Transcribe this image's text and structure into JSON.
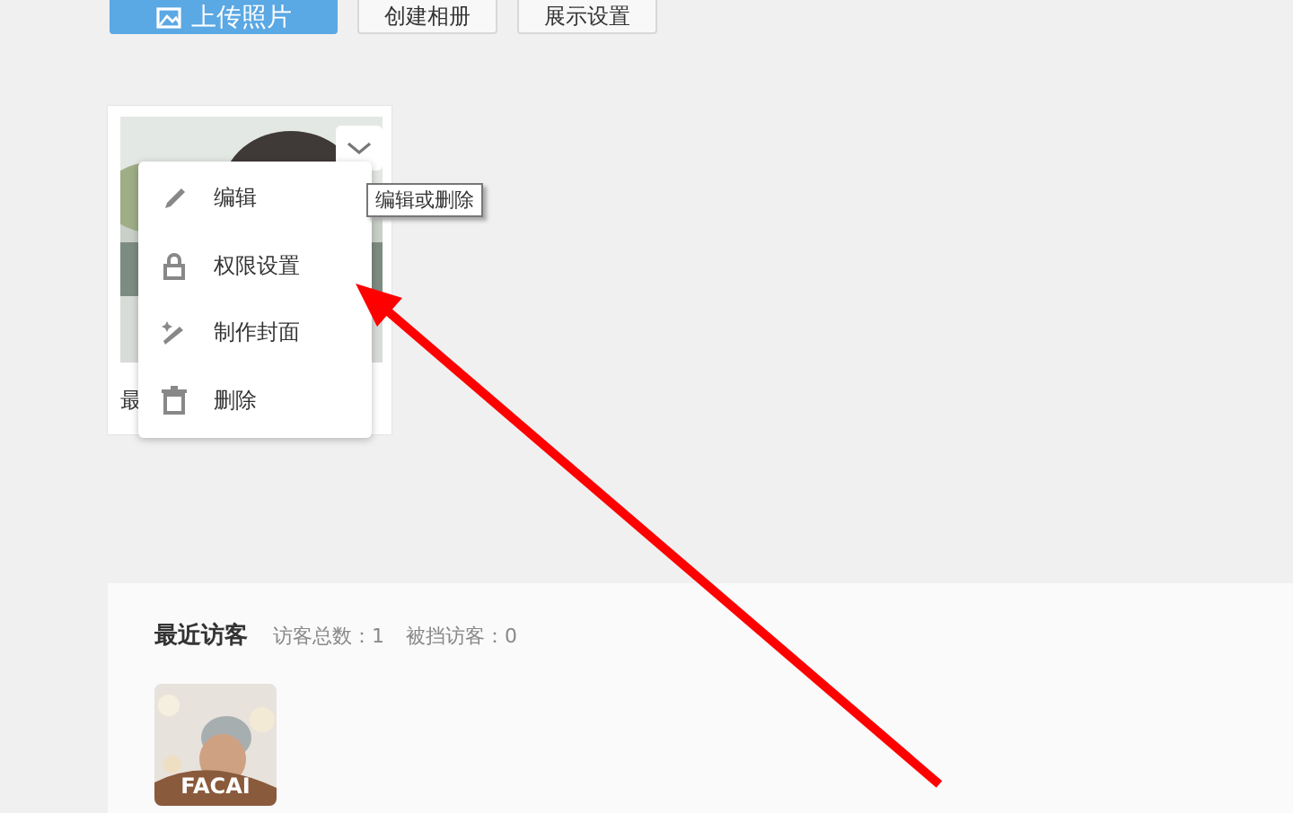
{
  "toolbar": {
    "buttons": [
      {
        "label": "上传照片",
        "kind": "primary"
      },
      {
        "label": "创建相册",
        "kind": "default"
      },
      {
        "label": "展示设置",
        "kind": "default"
      }
    ]
  },
  "album": {
    "caption": "最",
    "menu_button": {
      "expanded": true
    },
    "tooltip": "编辑或删除",
    "menu": [
      {
        "label": "编辑"
      },
      {
        "label": "权限设置"
      },
      {
        "label": "制作封面"
      },
      {
        "label": "删除"
      }
    ]
  },
  "visitors": {
    "title": "最近访客",
    "total": "访客总数：1",
    "blocked": "被挡访客：0",
    "items": [
      {
        "name": "FACAI"
      }
    ]
  }
}
